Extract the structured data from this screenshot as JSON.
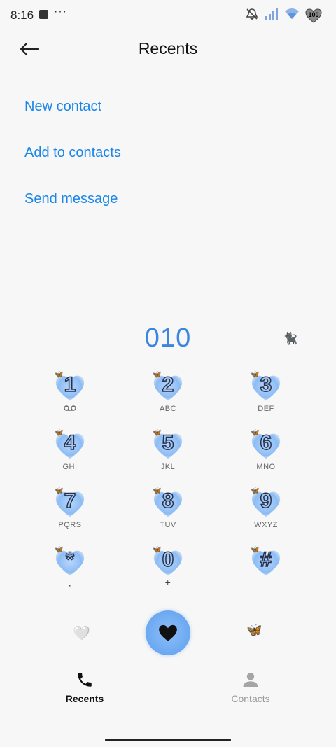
{
  "status_bar": {
    "time": "8:16",
    "overflow": "···",
    "battery_level": "100",
    "icons": [
      "app-notification-icon",
      "mute-alarm-icon",
      "signal-icon",
      "wifi-icon",
      "battery-heart-icon"
    ]
  },
  "header": {
    "title": "Recents",
    "back_icon": "back-arrow-icon"
  },
  "actions": {
    "new_contact": "New contact",
    "add_to_contacts": "Add to contacts",
    "send_message": "Send message"
  },
  "dialer": {
    "number": "010",
    "accent_color": "#3a86e0",
    "keys": [
      {
        "digit": "1",
        "sub": ""
      },
      {
        "digit": "2",
        "sub": "ABC"
      },
      {
        "digit": "3",
        "sub": "DEF"
      },
      {
        "digit": "4",
        "sub": "GHI"
      },
      {
        "digit": "5",
        "sub": "JKL"
      },
      {
        "digit": "6",
        "sub": "MNO"
      },
      {
        "digit": "7",
        "sub": "PQRS"
      },
      {
        "digit": "8",
        "sub": "TUV"
      },
      {
        "digit": "9",
        "sub": "WXYZ"
      },
      {
        "digit": "*",
        "sub": ","
      },
      {
        "digit": "0",
        "sub": "+"
      },
      {
        "digit": "#",
        "sub": ""
      }
    ]
  },
  "nav": {
    "recents": "Recents",
    "contacts": "Contacts"
  },
  "colors": {
    "link": "#1a86e8",
    "key_heart": "#8cbcf4",
    "call_button": "#6aa8f2"
  }
}
